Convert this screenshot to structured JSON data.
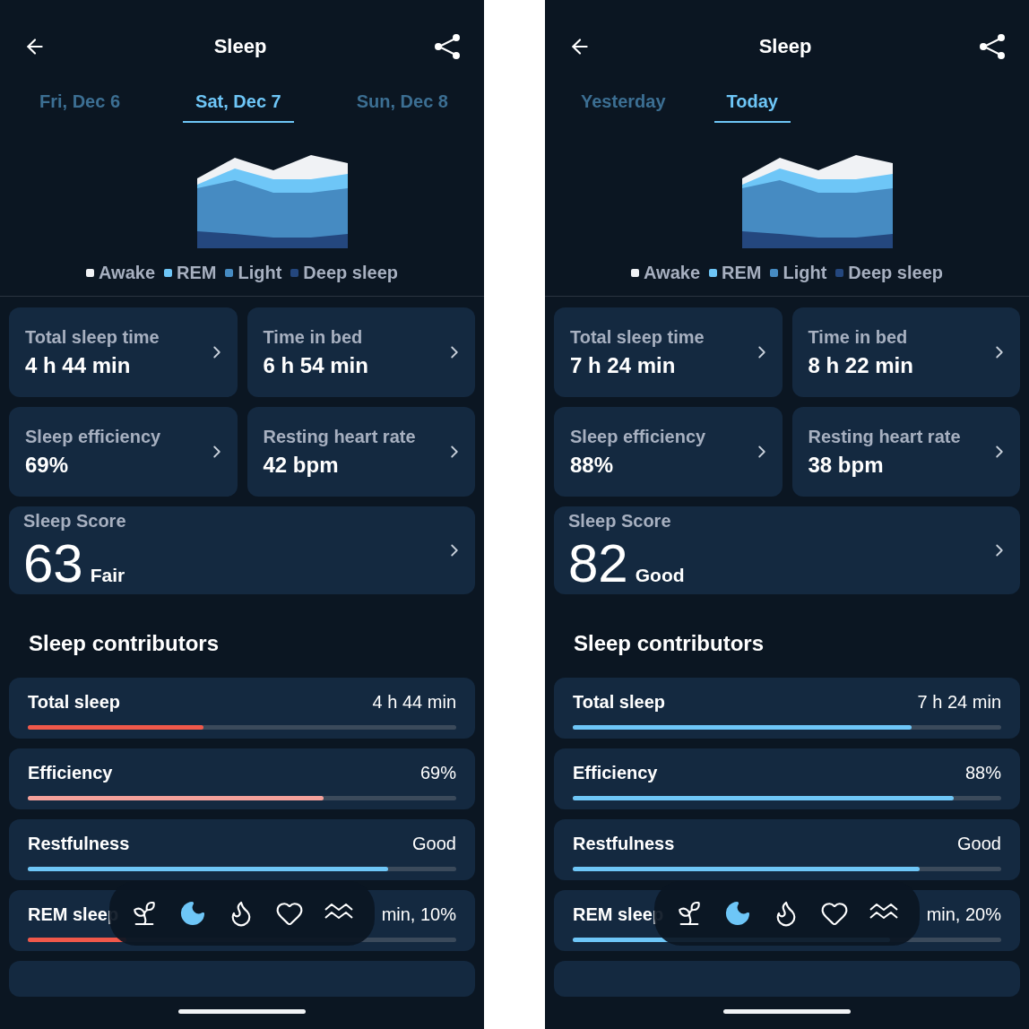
{
  "screens": [
    {
      "title": "Sleep",
      "tabs": [
        {
          "label": "Fri, Dec 6",
          "selected": false
        },
        {
          "label": "Sat, Dec 7",
          "selected": true
        },
        {
          "label": "Sun, Dec 8",
          "selected": false
        }
      ],
      "legend": [
        {
          "label": "Awake",
          "color": "#f0f2f5"
        },
        {
          "label": "REM",
          "color": "#6ec6f7"
        },
        {
          "label": "Light",
          "color": "#468bc2"
        },
        {
          "label": "Deep sleep",
          "color": "#24477e"
        }
      ],
      "stats": [
        {
          "label": "Total sleep time",
          "value": "4 h 44 min"
        },
        {
          "label": "Time in bed",
          "value": "6 h 54 min"
        },
        {
          "label": "Sleep efficiency",
          "value": "69%"
        },
        {
          "label": "Resting heart rate",
          "value": "42 bpm"
        }
      ],
      "score": {
        "label": "Sleep Score",
        "value": "63",
        "rating": "Fair"
      },
      "contributors_title": "Sleep contributors",
      "contributors": [
        {
          "name": "Total sleep",
          "value": "4 h 44 min",
          "level": 0.41,
          "color": "#f0584a"
        },
        {
          "name": "Efficiency",
          "value": "69%",
          "level": 0.69,
          "color": "#f4a09a"
        },
        {
          "name": "Restfulness",
          "value": "Good",
          "level": 0.84,
          "color": "#6ec6f7"
        },
        {
          "name": "REM sleep",
          "value": "min, 10%",
          "level": 0.23,
          "color": "#f0584a"
        }
      ],
      "nav": [
        {
          "kind": "sprout",
          "selected": false
        },
        {
          "kind": "moon",
          "selected": true
        },
        {
          "kind": "flame",
          "selected": false
        },
        {
          "kind": "heart",
          "selected": false
        },
        {
          "kind": "waves",
          "selected": false
        }
      ]
    },
    {
      "title": "Sleep",
      "tabs": [
        {
          "label": "Yesterday",
          "selected": false
        },
        {
          "label": "Today",
          "selected": true
        }
      ],
      "legend": [
        {
          "label": "Awake",
          "color": "#f0f2f5"
        },
        {
          "label": "REM",
          "color": "#6ec6f7"
        },
        {
          "label": "Light",
          "color": "#468bc2"
        },
        {
          "label": "Deep sleep",
          "color": "#24477e"
        }
      ],
      "stats": [
        {
          "label": "Total sleep time",
          "value": "7 h 24 min"
        },
        {
          "label": "Time in bed",
          "value": "8 h 22 min"
        },
        {
          "label": "Sleep efficiency",
          "value": "88%"
        },
        {
          "label": "Resting heart rate",
          "value": "38 bpm"
        }
      ],
      "score": {
        "label": "Sleep Score",
        "value": "82",
        "rating": "Good"
      },
      "contributors_title": "Sleep contributors",
      "contributors": [
        {
          "name": "Total sleep",
          "value": "7 h 24 min",
          "level": 0.79,
          "color": "#6ec6f7"
        },
        {
          "name": "Efficiency",
          "value": "88%",
          "level": 0.89,
          "color": "#6ec6f7"
        },
        {
          "name": "Restfulness",
          "value": "Good",
          "level": 0.81,
          "color": "#6ec6f7"
        },
        {
          "name": "REM sleep",
          "value": "min, 20%",
          "level": 0.74,
          "color": "#6ec6f7"
        }
      ],
      "nav": [
        {
          "kind": "sprout",
          "selected": false
        },
        {
          "kind": "moon",
          "selected": true
        },
        {
          "kind": "flame",
          "selected": false
        },
        {
          "kind": "heart",
          "selected": false
        },
        {
          "kind": "waves",
          "selected": false
        }
      ]
    }
  ]
}
